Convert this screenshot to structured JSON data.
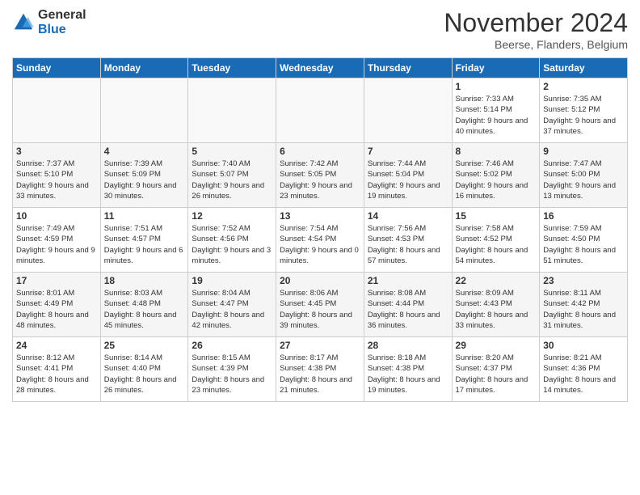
{
  "logo": {
    "general": "General",
    "blue": "Blue"
  },
  "title": "November 2024",
  "location": "Beerse, Flanders, Belgium",
  "headers": [
    "Sunday",
    "Monday",
    "Tuesday",
    "Wednesday",
    "Thursday",
    "Friday",
    "Saturday"
  ],
  "weeks": [
    [
      {
        "day": "",
        "info": ""
      },
      {
        "day": "",
        "info": ""
      },
      {
        "day": "",
        "info": ""
      },
      {
        "day": "",
        "info": ""
      },
      {
        "day": "",
        "info": ""
      },
      {
        "day": "1",
        "info": "Sunrise: 7:33 AM\nSunset: 5:14 PM\nDaylight: 9 hours\nand 40 minutes."
      },
      {
        "day": "2",
        "info": "Sunrise: 7:35 AM\nSunset: 5:12 PM\nDaylight: 9 hours\nand 37 minutes."
      }
    ],
    [
      {
        "day": "3",
        "info": "Sunrise: 7:37 AM\nSunset: 5:10 PM\nDaylight: 9 hours\nand 33 minutes."
      },
      {
        "day": "4",
        "info": "Sunrise: 7:39 AM\nSunset: 5:09 PM\nDaylight: 9 hours\nand 30 minutes."
      },
      {
        "day": "5",
        "info": "Sunrise: 7:40 AM\nSunset: 5:07 PM\nDaylight: 9 hours\nand 26 minutes."
      },
      {
        "day": "6",
        "info": "Sunrise: 7:42 AM\nSunset: 5:05 PM\nDaylight: 9 hours\nand 23 minutes."
      },
      {
        "day": "7",
        "info": "Sunrise: 7:44 AM\nSunset: 5:04 PM\nDaylight: 9 hours\nand 19 minutes."
      },
      {
        "day": "8",
        "info": "Sunrise: 7:46 AM\nSunset: 5:02 PM\nDaylight: 9 hours\nand 16 minutes."
      },
      {
        "day": "9",
        "info": "Sunrise: 7:47 AM\nSunset: 5:00 PM\nDaylight: 9 hours\nand 13 minutes."
      }
    ],
    [
      {
        "day": "10",
        "info": "Sunrise: 7:49 AM\nSunset: 4:59 PM\nDaylight: 9 hours\nand 9 minutes."
      },
      {
        "day": "11",
        "info": "Sunrise: 7:51 AM\nSunset: 4:57 PM\nDaylight: 9 hours\nand 6 minutes."
      },
      {
        "day": "12",
        "info": "Sunrise: 7:52 AM\nSunset: 4:56 PM\nDaylight: 9 hours\nand 3 minutes."
      },
      {
        "day": "13",
        "info": "Sunrise: 7:54 AM\nSunset: 4:54 PM\nDaylight: 9 hours\nand 0 minutes."
      },
      {
        "day": "14",
        "info": "Sunrise: 7:56 AM\nSunset: 4:53 PM\nDaylight: 8 hours\nand 57 minutes."
      },
      {
        "day": "15",
        "info": "Sunrise: 7:58 AM\nSunset: 4:52 PM\nDaylight: 8 hours\nand 54 minutes."
      },
      {
        "day": "16",
        "info": "Sunrise: 7:59 AM\nSunset: 4:50 PM\nDaylight: 8 hours\nand 51 minutes."
      }
    ],
    [
      {
        "day": "17",
        "info": "Sunrise: 8:01 AM\nSunset: 4:49 PM\nDaylight: 8 hours\nand 48 minutes."
      },
      {
        "day": "18",
        "info": "Sunrise: 8:03 AM\nSunset: 4:48 PM\nDaylight: 8 hours\nand 45 minutes."
      },
      {
        "day": "19",
        "info": "Sunrise: 8:04 AM\nSunset: 4:47 PM\nDaylight: 8 hours\nand 42 minutes."
      },
      {
        "day": "20",
        "info": "Sunrise: 8:06 AM\nSunset: 4:45 PM\nDaylight: 8 hours\nand 39 minutes."
      },
      {
        "day": "21",
        "info": "Sunrise: 8:08 AM\nSunset: 4:44 PM\nDaylight: 8 hours\nand 36 minutes."
      },
      {
        "day": "22",
        "info": "Sunrise: 8:09 AM\nSunset: 4:43 PM\nDaylight: 8 hours\nand 33 minutes."
      },
      {
        "day": "23",
        "info": "Sunrise: 8:11 AM\nSunset: 4:42 PM\nDaylight: 8 hours\nand 31 minutes."
      }
    ],
    [
      {
        "day": "24",
        "info": "Sunrise: 8:12 AM\nSunset: 4:41 PM\nDaylight: 8 hours\nand 28 minutes."
      },
      {
        "day": "25",
        "info": "Sunrise: 8:14 AM\nSunset: 4:40 PM\nDaylight: 8 hours\nand 26 minutes."
      },
      {
        "day": "26",
        "info": "Sunrise: 8:15 AM\nSunset: 4:39 PM\nDaylight: 8 hours\nand 23 minutes."
      },
      {
        "day": "27",
        "info": "Sunrise: 8:17 AM\nSunset: 4:38 PM\nDaylight: 8 hours\nand 21 minutes."
      },
      {
        "day": "28",
        "info": "Sunrise: 8:18 AM\nSunset: 4:38 PM\nDaylight: 8 hours\nand 19 minutes."
      },
      {
        "day": "29",
        "info": "Sunrise: 8:20 AM\nSunset: 4:37 PM\nDaylight: 8 hours\nand 17 minutes."
      },
      {
        "day": "30",
        "info": "Sunrise: 8:21 AM\nSunset: 4:36 PM\nDaylight: 8 hours\nand 14 minutes."
      }
    ]
  ]
}
